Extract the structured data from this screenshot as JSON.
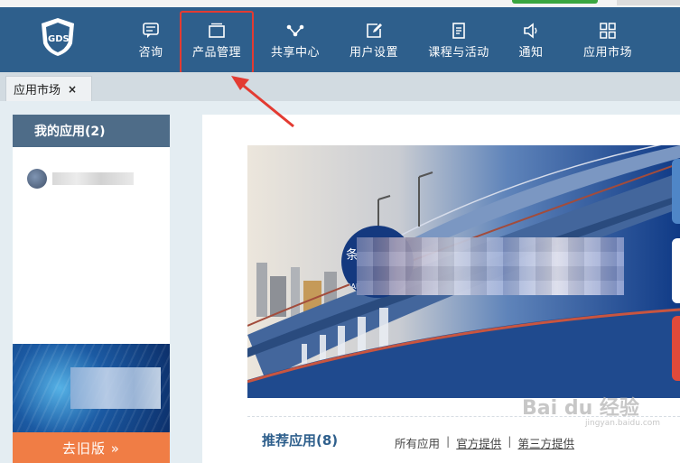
{
  "brand": {
    "logo_text": "GDS"
  },
  "nav": {
    "items": [
      {
        "label": "咨询",
        "icon": "chat-icon"
      },
      {
        "label": "产品管理",
        "icon": "folder-icon"
      },
      {
        "label": "共享中心",
        "icon": "share-icon"
      },
      {
        "label": "用户设置",
        "icon": "edit-icon"
      },
      {
        "label": "课程与活动",
        "icon": "document-icon"
      },
      {
        "label": "通知",
        "icon": "speaker-icon"
      },
      {
        "label": "应用市场",
        "icon": "grid-icon"
      }
    ]
  },
  "tabs": [
    {
      "label": "应用市场",
      "close": "×"
    }
  ],
  "sidebar": {
    "title": "我的应用(2)",
    "old_version": "去旧版 »"
  },
  "banner": {
    "badge_text": "条",
    "badge_sub": "BAF"
  },
  "recommended": {
    "title": "推荐应用(8)",
    "filters": [
      "所有应用",
      "官方提供",
      "第三方提供"
    ],
    "separator": "|"
  },
  "watermark": {
    "text": "Bai du 经验",
    "sub": "jingyan.baidu.com"
  },
  "colors": {
    "nav_bg": "#2e5f8c",
    "highlight": "#e33b32",
    "accent_orange": "#f07d45"
  }
}
